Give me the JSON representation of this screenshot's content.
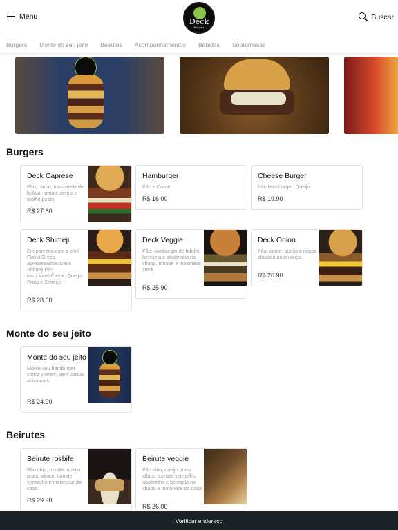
{
  "header": {
    "menu_label": "Menu",
    "logo_text": "Deck",
    "logo_subtext": "Burger",
    "search_label": "Buscar"
  },
  "categories": [
    "Burgers",
    "Monte do seu jeito",
    "Beirutes",
    "Acompanhamentos",
    "Bebidas",
    "Sobremesas"
  ],
  "sections": {
    "burgers": {
      "title": "Burgers",
      "items": [
        {
          "name": "Deck Caprese",
          "desc": "Pão, carne, mussarela de búfala, tomate cereja e molho pesto.",
          "price": "R$ 27.80"
        },
        {
          "name": "Hamburger",
          "desc": "Pão e Carne",
          "price": "R$ 16.00"
        },
        {
          "name": "Cheese Burger",
          "desc": "Pão,Hamburger ,Queijo",
          "price": "R$ 19.90"
        },
        {
          "name": "Deck Shimeji",
          "desc": "Em parceria com a chef Flavia Greco, apresentamos Deck Shimeji:Pão tradicional,Carne, Queijo Prato e Shimeji.",
          "price": "R$ 28.60"
        },
        {
          "name": "Deck Veggie",
          "desc": "Pão,Hamburger de falafel, berinjela e abobrinha na chapa, tomate e maionese Deck.",
          "price": "R$ 25.90"
        },
        {
          "name": "Deck Onion",
          "desc": "Pão, carne, queijo e nossa clássica onion rings.",
          "price": "R$ 26.90"
        }
      ]
    },
    "monte": {
      "title": "Monte do seu jeito",
      "items": [
        {
          "name": "Monte do seu jeito",
          "desc": "Monte seu hamburger como preferir, sem custos adicionais.",
          "price": "R$ 24.90"
        }
      ]
    },
    "beirutes": {
      "title": "Beirutes",
      "items": [
        {
          "name": "Beirute rosbife",
          "desc": "Pão sírio, rosbife, queijo prato, alface, tomate vermelho e maionese da casa.",
          "price": "R$ 29.90"
        },
        {
          "name": "Beirute veggie",
          "desc": "Pão sírio, queijo prato, alface, tomate vermelho, abobrinha e berinjela na chapa e maionese da casa",
          "price": "R$ 26.00"
        }
      ]
    }
  },
  "footer": {
    "cta_label": "Verificar endereço"
  }
}
